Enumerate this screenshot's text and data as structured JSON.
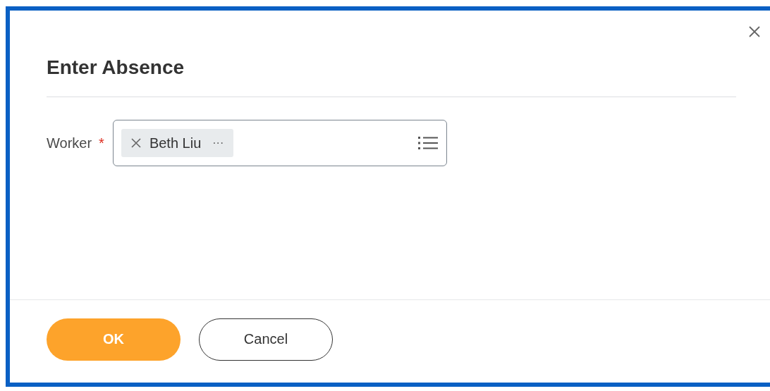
{
  "dialog": {
    "title": "Enter Absence"
  },
  "fields": [
    {
      "label": "Worker",
      "required_mark": "*",
      "tokens": [
        {
          "text": "Beth Liu",
          "more": "···"
        }
      ]
    }
  ],
  "buttons": [
    {
      "label": "OK",
      "kind": "primary"
    },
    {
      "label": "Cancel",
      "kind": "secondary"
    }
  ]
}
